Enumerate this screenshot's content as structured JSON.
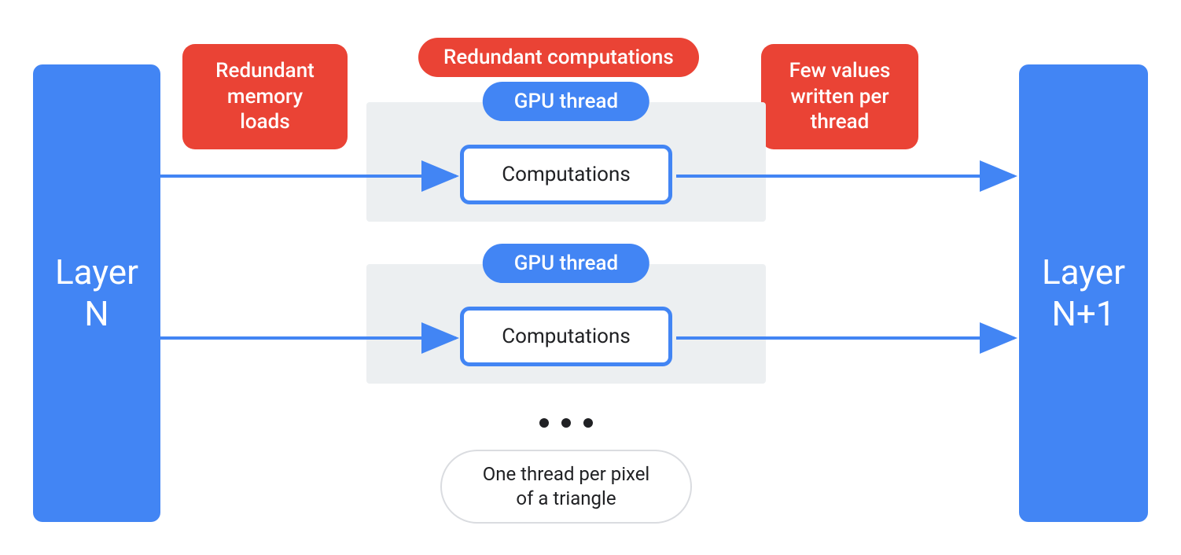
{
  "colors": {
    "blue": "#4285f4",
    "red": "#ea4335",
    "gray_bg": "#eceff1",
    "text": "#202124"
  },
  "layer_left": {
    "label": "Layer\nN"
  },
  "layer_right": {
    "label": "Layer\nN+1"
  },
  "labels": {
    "redundant_loads": "Redundant\nmemory\nloads",
    "redundant_comps": "Redundant computations",
    "few_values": "Few values\nwritten per\nthread"
  },
  "threads": [
    {
      "pill": "GPU thread",
      "box": "Computations"
    },
    {
      "pill": "GPU thread",
      "box": "Computations"
    }
  ],
  "ellipsis": "•••",
  "caption": "One thread per pixel\nof a triangle"
}
